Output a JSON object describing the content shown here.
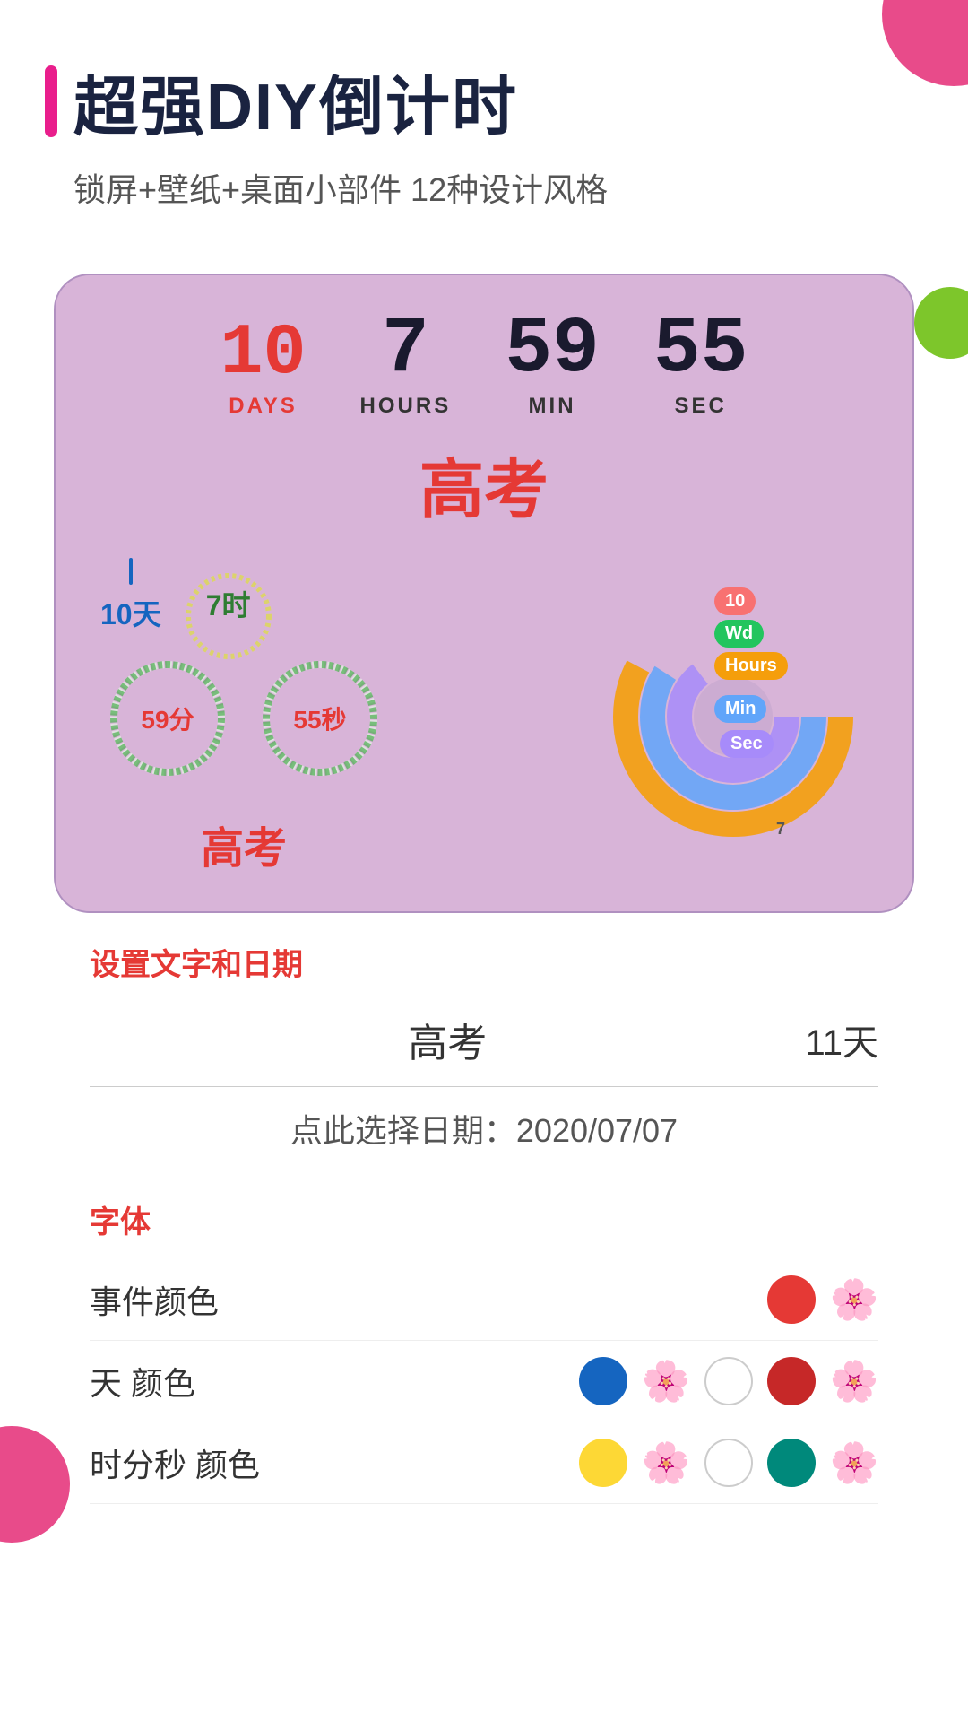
{
  "header": {
    "title": "超强DIY倒计时",
    "subtitle": "锁屏+壁纸+桌面小部件  12种设计风格",
    "pink_bar": true
  },
  "timer": {
    "days_number": "10",
    "days_label": "DAYS",
    "hours_number": "7",
    "hours_label": "HOURS",
    "min_number": "59",
    "min_label": "MIN",
    "sec_number": "55",
    "sec_label": "SEC"
  },
  "event": {
    "name": "高考"
  },
  "widgets": {
    "text_days": "10天",
    "text_hours": "7时",
    "text_mins": "59分",
    "text_secs": "55秒",
    "event_name": "高考",
    "donut": {
      "days_val": "10",
      "wd_label": "Wd",
      "hours_label": "Hours",
      "min_label": "Min",
      "sec_label": "Sec",
      "num_7": "7"
    }
  },
  "bottom": {
    "settings_label": "设置文字和日期",
    "event_input": "高考",
    "days_count": "11天",
    "date_label": "点此选择日期：2020/07/07",
    "font_label": "字体",
    "color_rows": [
      {
        "label": "事件颜色",
        "dots": [
          "red",
          "flower"
        ]
      },
      {
        "label": "天  颜色",
        "dots": [
          "blue",
          "flower",
          "white",
          "dark-red",
          "flower"
        ]
      },
      {
        "label": "时分秒 颜色",
        "dots": [
          "yellow",
          "flower",
          "white",
          "teal",
          "flower"
        ]
      }
    ]
  }
}
